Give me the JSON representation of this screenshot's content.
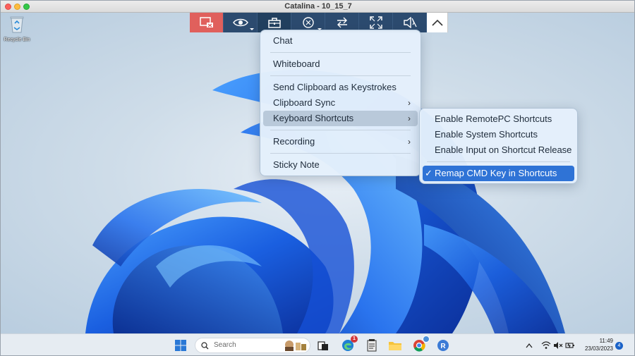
{
  "window": {
    "title": "Catalina - 10_15_7"
  },
  "desktop": {
    "recycle_bin_label": "Recycle Bin"
  },
  "toolbar": {
    "buttons": [
      {
        "icon": "end-session-icon"
      },
      {
        "icon": "eye-icon"
      },
      {
        "icon": "toolbox-icon"
      },
      {
        "icon": "effects-icon"
      },
      {
        "icon": "transfer-icon"
      },
      {
        "icon": "fullscreen-icon"
      },
      {
        "icon": "speaker-icon"
      },
      {
        "icon": "chevron-up-icon"
      }
    ]
  },
  "main_menu": {
    "items": [
      {
        "label": "Chat"
      },
      {
        "label": "Whiteboard"
      },
      {
        "label": "Send Clipboard as Keystrokes"
      },
      {
        "label": "Clipboard Sync",
        "arrow": "›"
      },
      {
        "label": "Keyboard Shortcuts",
        "arrow": "›"
      },
      {
        "label": "Recording",
        "arrow": "›"
      },
      {
        "label": "Sticky Note"
      }
    ]
  },
  "sub_menu": {
    "items": [
      {
        "label": "Enable RemotePC Shortcuts"
      },
      {
        "label": "Enable System Shortcuts"
      },
      {
        "label": "Enable Input on Shortcut Release"
      },
      {
        "label": "Remap CMD Key in Shortcuts",
        "check": "✓"
      }
    ]
  },
  "taskbar": {
    "search_placeholder": "Search",
    "edge_badge": "1",
    "time": "11:49",
    "date": "23/03/2023",
    "notification_count": "4"
  },
  "colors": {
    "toolbar_bg": "#2c4b6f",
    "toolbar_red": "#e0605c",
    "menu_selected": "#2f73d6"
  }
}
